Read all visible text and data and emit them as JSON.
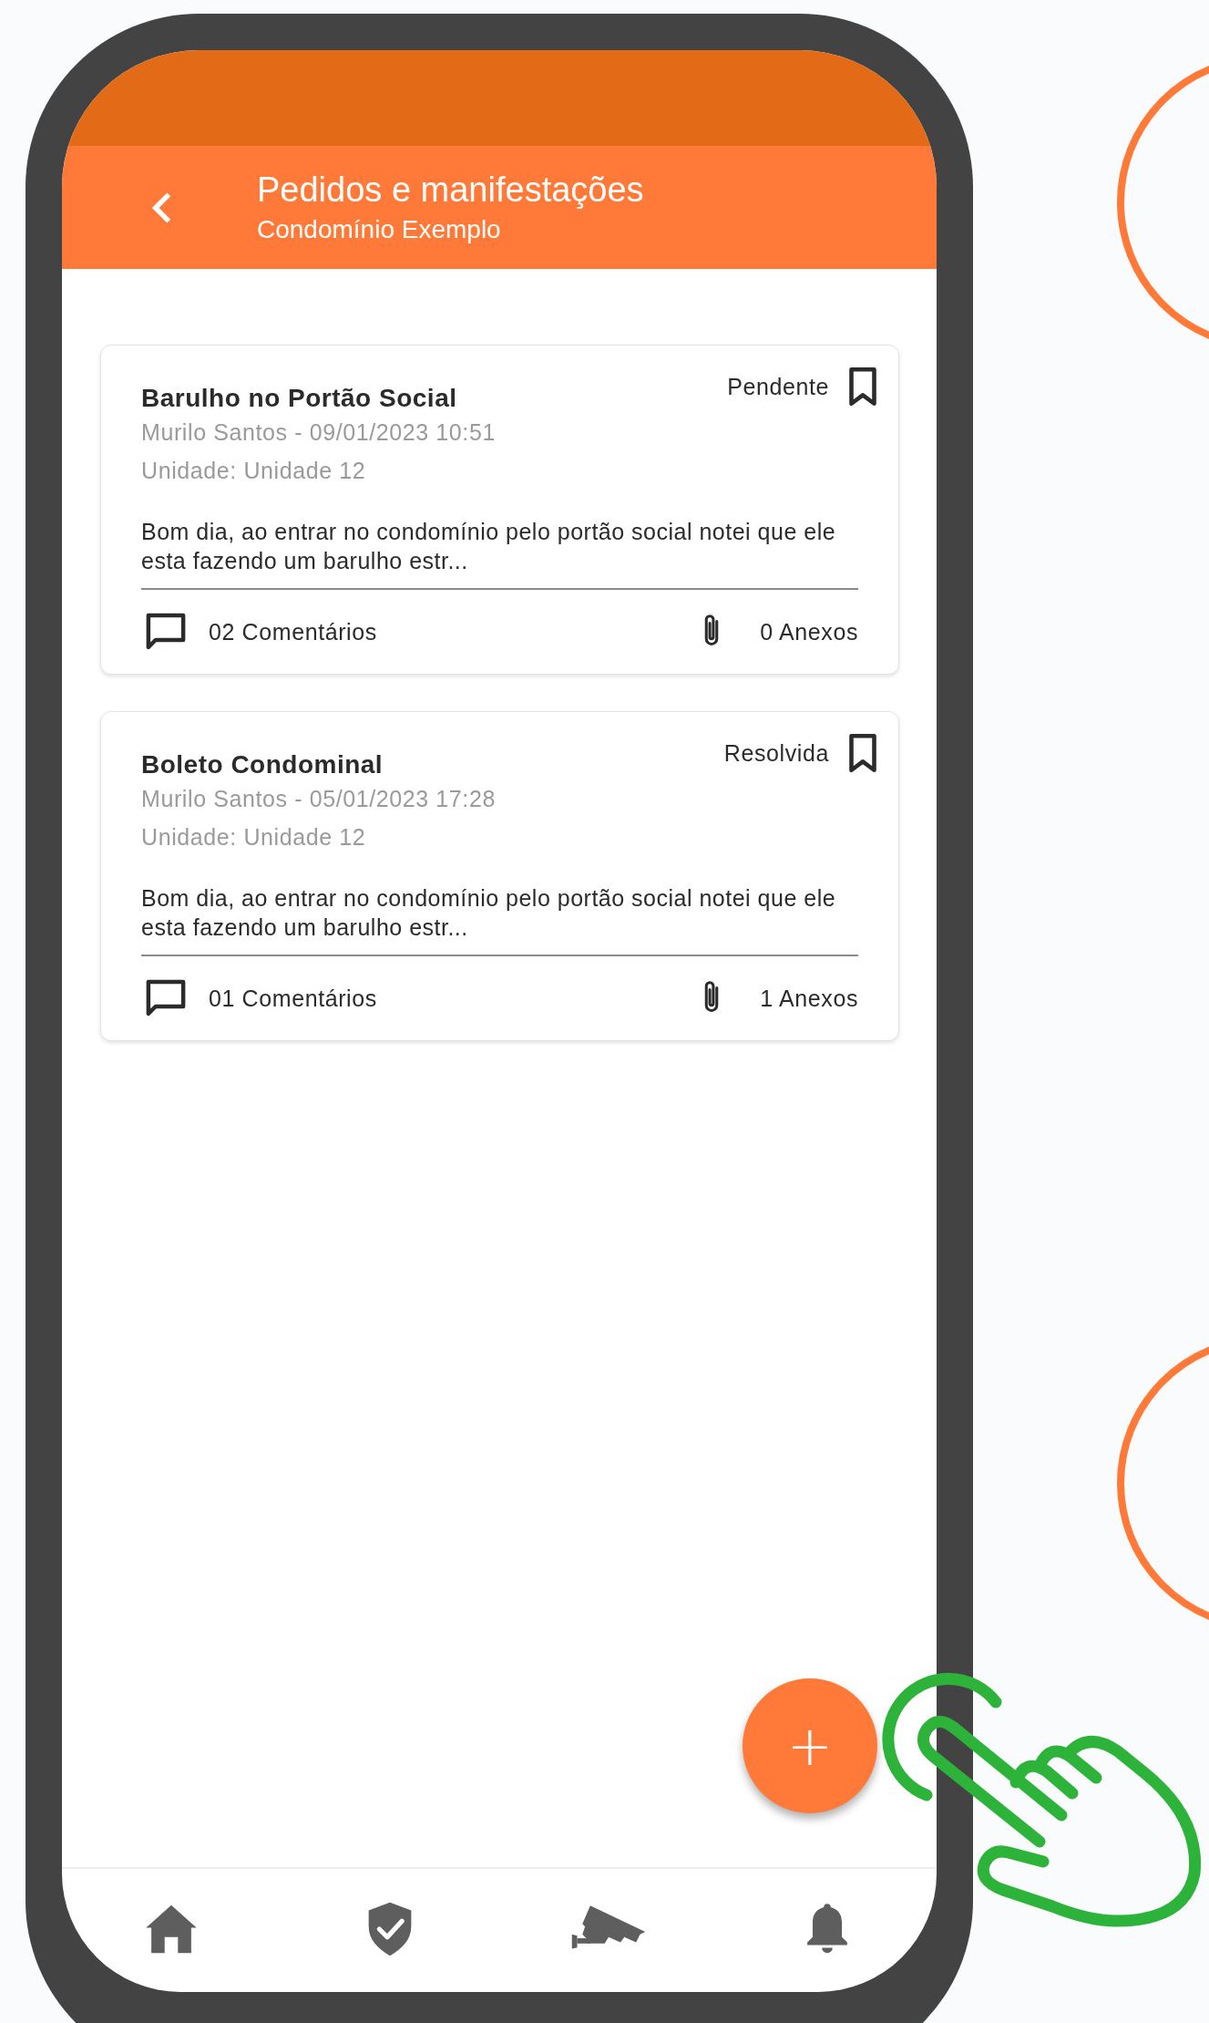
{
  "header": {
    "title": "Pedidos e manifestações",
    "subtitle": "Condomínio Exemplo"
  },
  "requests": [
    {
      "title": "Barulho no Portão Social",
      "status": "Pendente",
      "author_date": "Murilo Santos - 09/01/2023 10:51",
      "unit": "Unidade: Unidade 12",
      "description": "Bom dia, ao entrar no condomínio pelo portão social notei que ele esta fazendo um barulho estr...",
      "comments": "02 Comentários",
      "attachments": "0 Anexos"
    },
    {
      "title": "Boleto Condominal",
      "status": "Resolvida",
      "author_date": "Murilo Santos - 05/01/2023 17:28",
      "unit": "Unidade: Unidade 12",
      "description": "Bom dia, ao entrar no condomínio pelo portão social notei que ele esta fazendo um barulho estr...",
      "comments": "01 Comentários",
      "attachments": "1 Anexos"
    }
  ],
  "fab": {
    "label": "+"
  },
  "bottom_nav": [
    {
      "kind": "home"
    },
    {
      "kind": "shield"
    },
    {
      "kind": "camera"
    },
    {
      "kind": "bell"
    }
  ]
}
